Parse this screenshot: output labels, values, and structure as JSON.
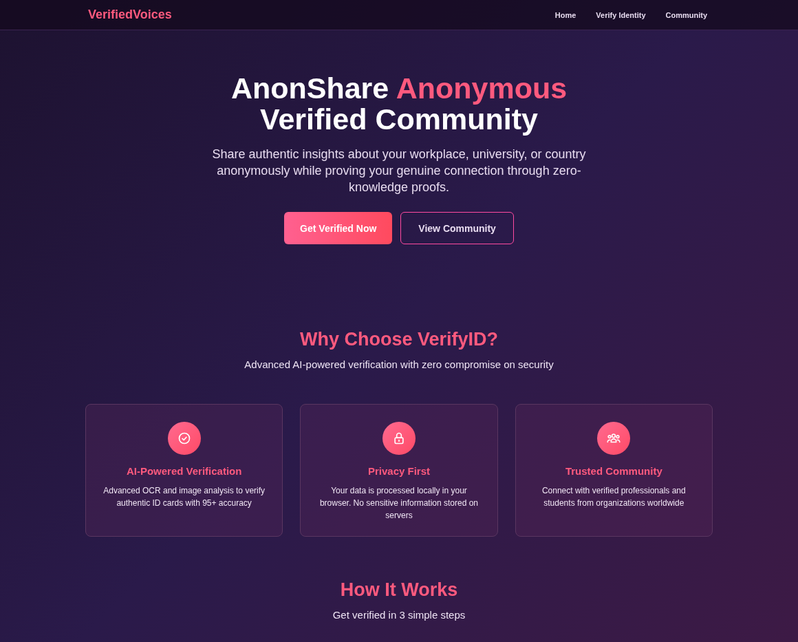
{
  "nav": {
    "logo": "VerifiedVoices",
    "links": [
      {
        "label": "Home"
      },
      {
        "label": "Verify Identity"
      },
      {
        "label": "Community"
      }
    ]
  },
  "hero": {
    "title_lead": "AnonShare",
    "title_highlight": "Anonymous",
    "title_rest": "Verified Community",
    "subtitle": "Share authentic insights about your workplace, university, or country anonymously while proving your genuine connection through zero-knowledge proofs.",
    "buttons": [
      {
        "label": "Get Verified Now",
        "kind": "primary"
      },
      {
        "label": "View Community",
        "kind": "outline"
      }
    ]
  },
  "features": {
    "title": "Why Choose VerifyID?",
    "subtitle": "Advanced AI-powered verification with zero compromise on security",
    "cards": [
      {
        "title": "AI-Powered Verification",
        "description": "Advanced OCR and image analysis to verify authentic ID cards with 95+ accuracy"
      },
      {
        "title": "Privacy First",
        "description": "Your data is processed locally in your browser. No sensitive information stored on servers"
      },
      {
        "title": "Trusted Community",
        "description": "Connect with verified professionals and students from organizations worldwide"
      }
    ]
  },
  "how_it_works": {
    "title": "How It Works",
    "subtitle": "Get verified in 3 simple steps"
  }
}
